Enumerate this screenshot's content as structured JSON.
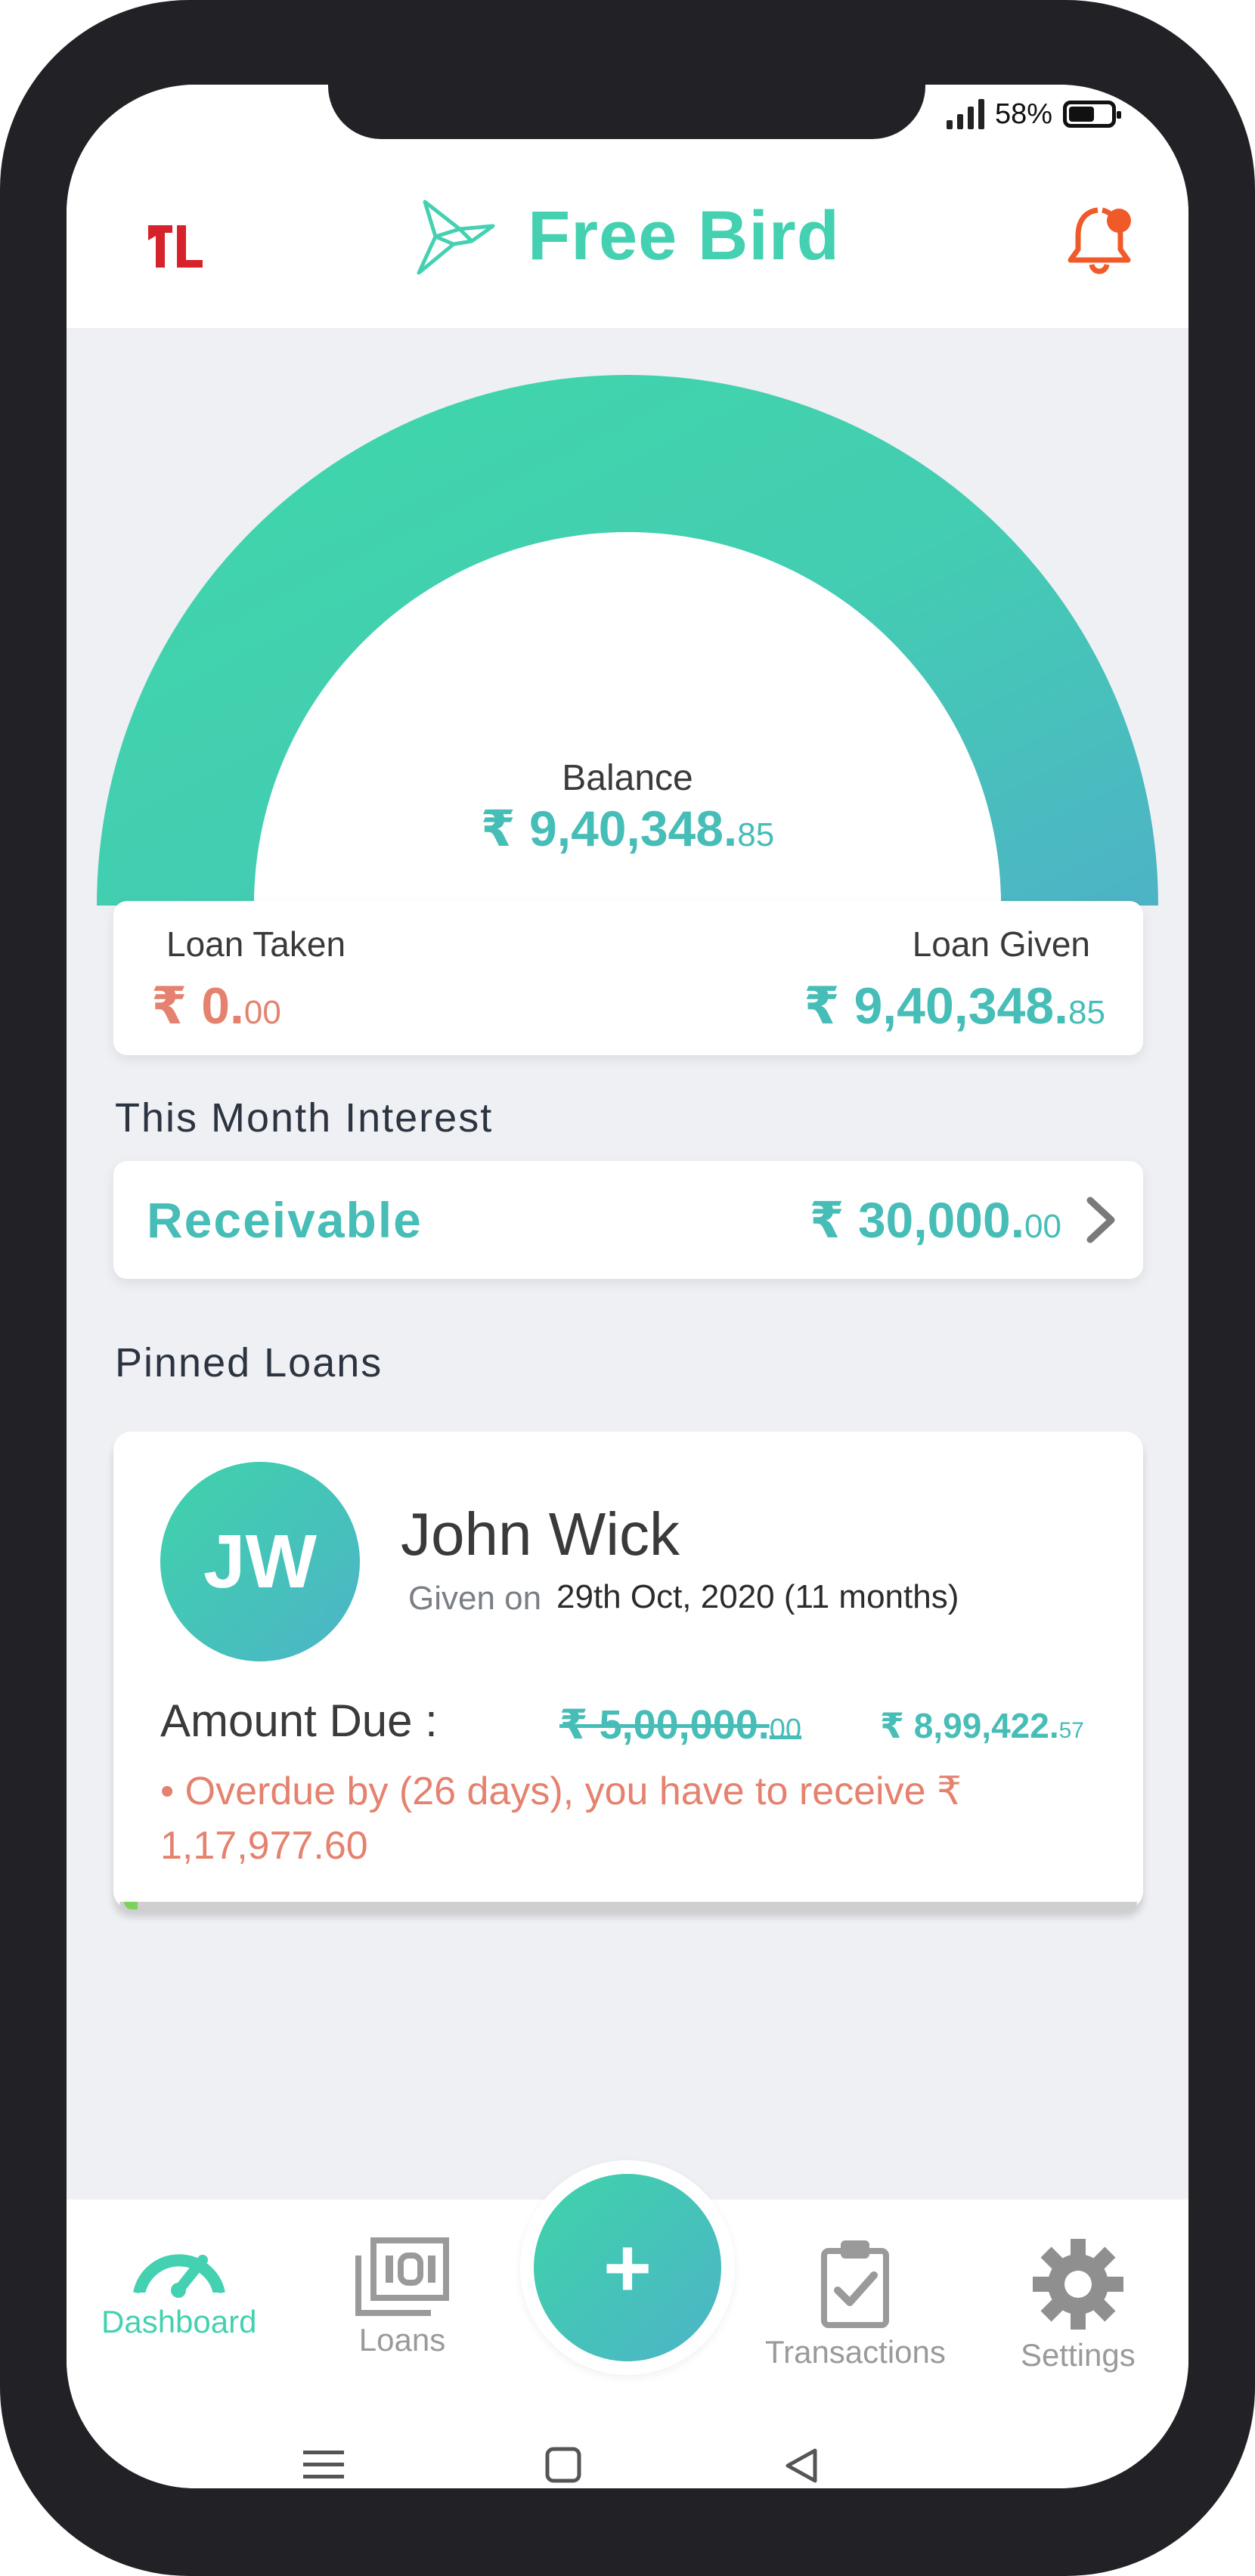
{
  "status_bar": {
    "battery": "58%"
  },
  "header": {
    "left_logo": "logo-icon",
    "brand_name": "Free Bird",
    "notification": "bell-icon"
  },
  "balance": {
    "label": "Balance",
    "value_main": "₹ 9,40,348.",
    "value_dec": "85"
  },
  "loans_summary": {
    "taken_label": "Loan Taken",
    "taken_main": "₹ 0.",
    "taken_dec": "00",
    "given_label": "Loan Given",
    "given_main": "₹ 9,40,348.",
    "given_dec": "85"
  },
  "interest": {
    "section_title": "This Month Interest",
    "label": "Receivable",
    "value_main": "₹ 30,000.",
    "value_dec": "00"
  },
  "pinned": {
    "section_title": "Pinned Loans",
    "initials": "JW",
    "name": "John Wick",
    "given_label": "Given on",
    "given_date": "29th Oct, 2020  (11 months)",
    "amount_due_label": "Amount Due :",
    "original_main": "₹ 5,00,000.",
    "original_dec": "00",
    "current_main": "₹ 8,99,422.",
    "current_dec": "57",
    "overdue_text": "• Overdue by (26 days), you have to receive ₹ 1,17,977.60"
  },
  "bottom_nav": {
    "dashboard": "Dashboard",
    "loans": "Loans",
    "add": "+",
    "transactions": "Transactions",
    "settings": "Settings"
  },
  "colors": {
    "accent": "#44d1b1",
    "teal_value": "#47bdb7",
    "warning": "#e5826f",
    "bell": "#f05a28",
    "logo": "#d6222b"
  }
}
